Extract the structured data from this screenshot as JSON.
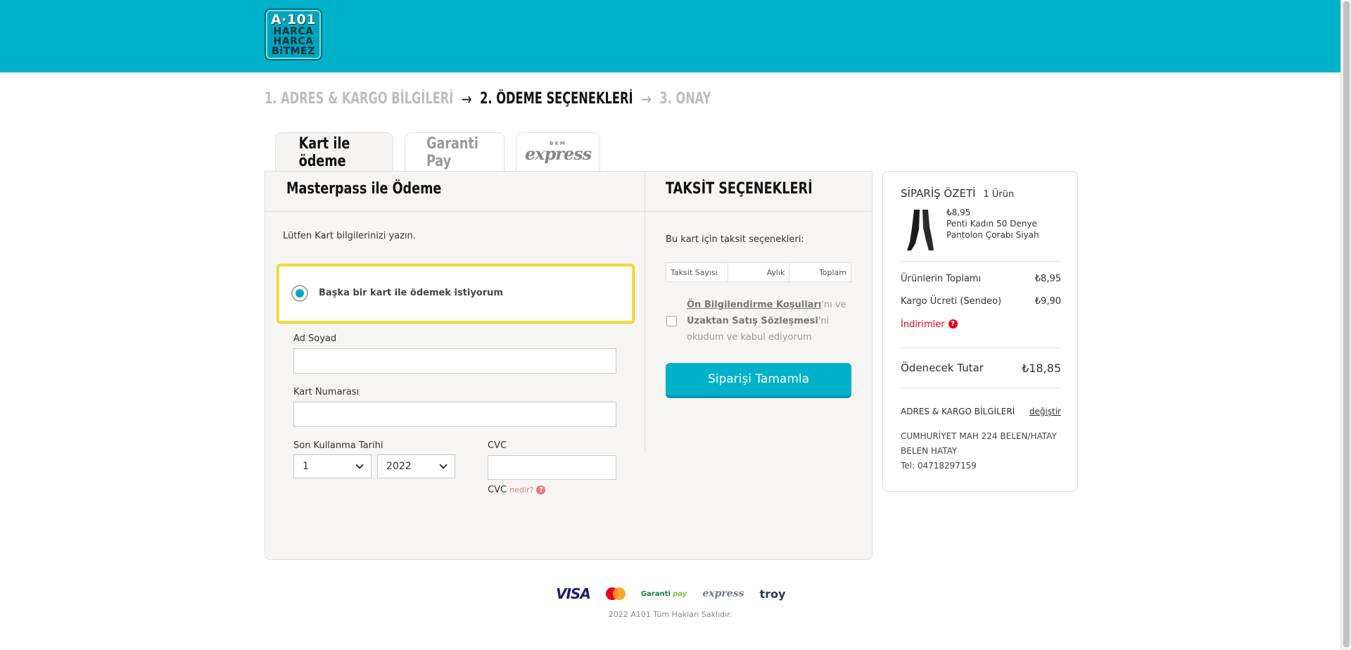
{
  "brand": {
    "logo_lines": [
      "A·101",
      "HARCA",
      "HARCA",
      "BiTMEZ"
    ]
  },
  "steps": [
    {
      "label": "1. ADRES & KARGO BİLGİLERİ",
      "state": "done"
    },
    {
      "label": "2. ÖDEME SEÇENEKLERİ",
      "state": "active"
    },
    {
      "label": "3. ONAY",
      "state": "next"
    }
  ],
  "tabs": [
    {
      "label": "Kart ile ödeme",
      "active": true
    },
    {
      "label": "Garanti Pay",
      "active": false
    },
    {
      "label": "express",
      "badge": "BKM",
      "active": false
    }
  ],
  "payment": {
    "title": "Masterpass ile Ödeme",
    "instruction": "Lütfen Kart bilgilerinizi yazın.",
    "other_card_option": "Başka bir kart ile ödemek istiyorum",
    "name_label": "Ad Soyad",
    "card_number_label": "Kart Numarası",
    "expiry_label": "Son Kullanma Tarihi",
    "expiry_month": "1",
    "expiry_year": "2022",
    "cvc_label": "CVC",
    "cvc_help_prefix": "CVC",
    "cvc_help_link": "nedir?",
    "name_value": "",
    "card_number_value": "",
    "cvc_value": ""
  },
  "installments": {
    "title": "TAKSİT SEÇENEKLERİ",
    "subtitle": "Bu kart için taksit seçenekleri:",
    "columns": [
      "Taksit Sayısı",
      "Aylık",
      "Toplam"
    ],
    "terms_link1": "Ön Bilgilendirme Koşulları",
    "terms_text1": "'nı ve",
    "terms_link2": "Uzaktan Satış Sözleşmesi",
    "terms_text2": "'ni okudum ve kabul ediyorum",
    "submit_label": "Siparişi Tamamla"
  },
  "summary": {
    "title": "SİPARİŞ ÖZETİ",
    "item_count": "1 Ürün",
    "product_price": "₺8,95",
    "product_name": "Penti Kadın 50 Denye Pantolon Çorabı Siyah",
    "subtotal_label": "Ürünlerin Toplamı",
    "subtotal_value": "₺8,95",
    "shipping_label": "Kargo Ücreti (Sendeo)",
    "shipping_value": "₺9,90",
    "discounts_label": "İndirimler",
    "total_label": "Ödenecek Tutar",
    "total_value": "₺18,85",
    "address_title": "ADRES & KARGO BİLGİLERİ",
    "change_link": "değiştir",
    "address_line1": "CUMHURİYET MAH 224 BELEN/HATAY",
    "address_line2": "BELEN HATAY",
    "phone": "Tel: 04718297159"
  },
  "footer": {
    "visa": "VISA",
    "mastercard_text": "MasterCard",
    "garanti": "Garanti",
    "garanti_pay": "pay",
    "bkm_express": "express",
    "troy": "troy",
    "copyright": "2022 A101 Tüm Hakları Saklıdır."
  },
  "colors": {
    "header": "#00b2c9",
    "option_highlight": "#f5df3b",
    "discount_red": "#e0001b",
    "cvc_help_red": "#e8787d"
  }
}
